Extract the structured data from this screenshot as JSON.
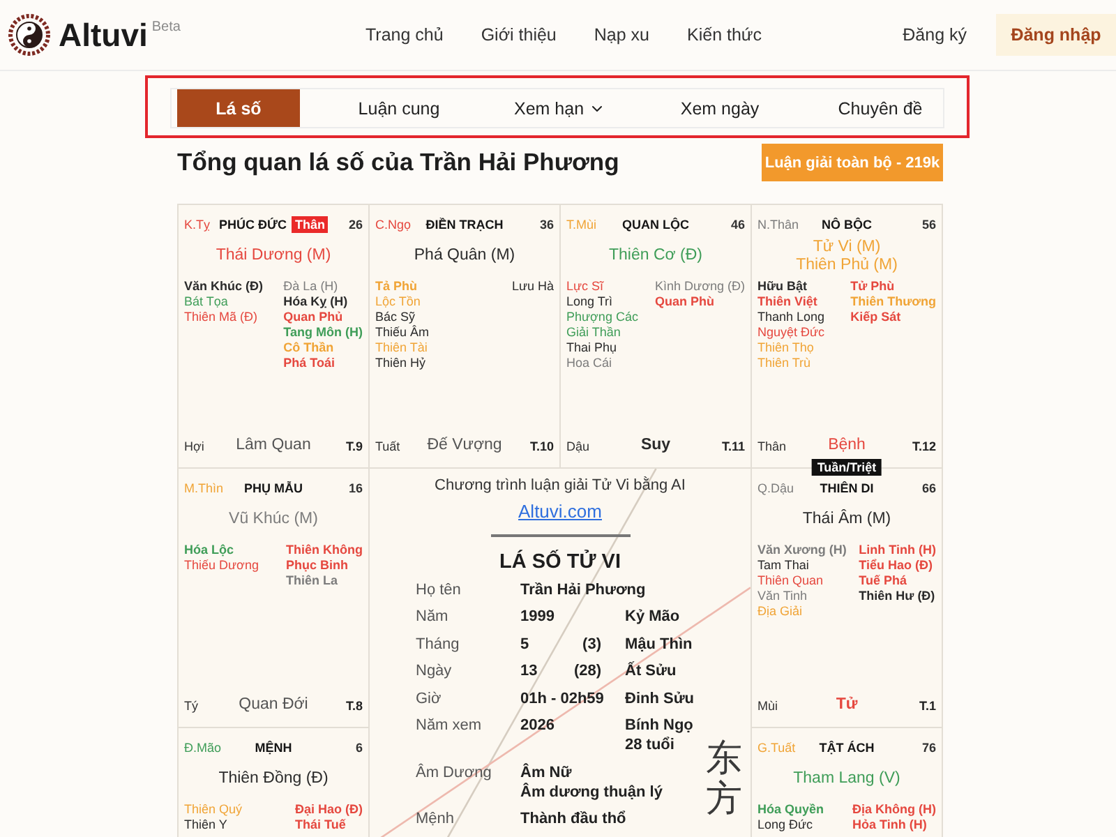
{
  "header": {
    "brand": "Altuvi",
    "badge": "Beta",
    "nav": [
      "Trang chủ",
      "Giới thiệu",
      "Nạp xu",
      "Kiến thức"
    ],
    "register": "Đăng ký",
    "login": "Đăng nhập"
  },
  "tabs": [
    {
      "label": "Lá số",
      "selected": true,
      "has_menu": false
    },
    {
      "label": "Luận cung",
      "selected": false,
      "has_menu": false
    },
    {
      "label": "Xem hạn",
      "selected": false,
      "has_menu": true
    },
    {
      "label": "Xem ngày",
      "selected": false,
      "has_menu": false
    },
    {
      "label": "Chuyên đề",
      "selected": false,
      "has_menu": false
    }
  ],
  "title": "Tổng quan lá số của Trần Hải Phương",
  "action_button": "Luận giải toàn bộ - 219k",
  "chart": {
    "palaces": [
      {
        "can_chi": {
          "text": "K.Tỵ",
          "color": "#e5483f"
        },
        "name": "PHÚC ĐỨC",
        "tag": "Thân",
        "age": "26",
        "main_stars": [
          {
            "name": "Thái Dương (M)",
            "color": "#e5483f"
          }
        ],
        "left_stars": [
          {
            "name": "Văn Khúc (Đ)",
            "color": "#2b2b2b",
            "bold": true
          },
          {
            "name": "Bát Tọa",
            "color": "#3f9d58",
            "bold": false
          },
          {
            "name": "Thiên Mã (Đ)",
            "color": "#e5483f",
            "bold": false
          }
        ],
        "right_stars": [
          {
            "name": "Đà La (H)",
            "color": "#7c7c7c",
            "bold": false
          },
          {
            "name": "Hóa Kỵ (H)",
            "color": "#2b2b2b",
            "bold": true
          },
          {
            "name": "Quan Phủ",
            "color": "#e5483f",
            "bold": true
          },
          {
            "name": "Tang Môn (H)",
            "color": "#3f9d58",
            "bold": true
          },
          {
            "name": "Cô Thần",
            "color": "#f0a436",
            "bold": true
          },
          {
            "name": "Phá Toái",
            "color": "#e5483f",
            "bold": true
          }
        ],
        "footer": {
          "branch": "Hợi",
          "stage": {
            "text": "Lâm Quan",
            "color": "#555555",
            "bold": false
          },
          "month": "T.9"
        }
      },
      {
        "can_chi": {
          "text": "C.Ngọ",
          "color": "#e5483f"
        },
        "name": "ĐIỀN TRẠCH",
        "age": "36",
        "main_stars": [
          {
            "name": "Phá Quân (M)",
            "color": "#2b2b2b"
          }
        ],
        "left_stars": [
          {
            "name": "Tả Phù",
            "color": "#f0a436",
            "bold": true
          },
          {
            "name": "Lộc Tồn",
            "color": "#f0a436",
            "bold": false
          },
          {
            "name": "Bác Sỹ",
            "color": "#2b2b2b",
            "bold": false
          },
          {
            "name": "Thiếu Âm",
            "color": "#2b2b2b",
            "bold": false
          },
          {
            "name": "Thiên Tài",
            "color": "#f0a436",
            "bold": false
          },
          {
            "name": "Thiên Hỷ",
            "color": "#2b2b2b",
            "bold": false
          }
        ],
        "right_stars": [
          {
            "name": "Lưu Hà",
            "color": "#2b2b2b",
            "bold": false
          }
        ],
        "footer": {
          "branch": "Tuất",
          "stage": {
            "text": "Đế Vượng",
            "color": "#555555",
            "bold": false
          },
          "month": "T.10"
        }
      },
      {
        "can_chi": {
          "text": "T.Mùi",
          "color": "#f0a436"
        },
        "name": "QUAN LỘC",
        "age": "46",
        "main_stars": [
          {
            "name": "Thiên Cơ (Đ)",
            "color": "#3f9d58"
          }
        ],
        "left_stars": [
          {
            "name": "Lực Sĩ",
            "color": "#e5483f",
            "bold": false
          },
          {
            "name": "Long Trì",
            "color": "#2b2b2b",
            "bold": false
          },
          {
            "name": "Phượng Các",
            "color": "#3f9d58",
            "bold": false
          },
          {
            "name": "Giải Thần",
            "color": "#3f9d58",
            "bold": false
          },
          {
            "name": "Thai Phụ",
            "color": "#2b2b2b",
            "bold": false
          },
          {
            "name": "Hoa Cái",
            "color": "#7c7c7c",
            "bold": false
          }
        ],
        "right_stars": [
          {
            "name": "Kình Dương (Đ)",
            "color": "#7c7c7c",
            "bold": false
          },
          {
            "name": "Quan Phù",
            "color": "#e5483f",
            "bold": true
          }
        ],
        "footer": {
          "branch": "Dậu",
          "stage": {
            "text": "Suy",
            "color": "#2b2b2b",
            "bold": true
          },
          "month": "T.11"
        }
      },
      {
        "can_chi": {
          "text": "N.Thân",
          "color": "#7c7c7c"
        },
        "name": "NÔ BỘC",
        "age": "56",
        "main_stars": [
          {
            "name": "Tử Vi (M)",
            "color": "#f0a436"
          },
          {
            "name": "Thiên Phủ (M)",
            "color": "#f0a436"
          }
        ],
        "left_stars": [
          {
            "name": "Hữu Bật",
            "color": "#2b2b2b",
            "bold": true
          },
          {
            "name": "Thiên Việt",
            "color": "#e5483f",
            "bold": true
          },
          {
            "name": "Thanh Long",
            "color": "#2b2b2b",
            "bold": false
          },
          {
            "name": "Nguyệt Đức",
            "color": "#e5483f",
            "bold": false
          },
          {
            "name": "Thiên Thọ",
            "color": "#f0a436",
            "bold": false
          },
          {
            "name": "Thiên Trù",
            "color": "#f0a436",
            "bold": false
          }
        ],
        "right_stars": [
          {
            "name": "Tử Phù",
            "color": "#e5483f",
            "bold": true
          },
          {
            "name": "Thiên Thương",
            "color": "#f0a436",
            "bold": true
          },
          {
            "name": "Kiếp Sát",
            "color": "#e5483f",
            "bold": true
          }
        ],
        "footer": {
          "branch": "Thân",
          "stage": {
            "text": "Bệnh",
            "color": "#e5483f",
            "bold": false
          },
          "month": "T.12"
        }
      },
      {
        "can_chi": {
          "text": "M.Thìn",
          "color": "#f0a436"
        },
        "name": "PHỤ MẪU",
        "age": "16",
        "main_stars": [
          {
            "name": "Vũ Khúc (M)",
            "color": "#7c7c7c"
          }
        ],
        "left_stars": [
          {
            "name": "Hóa Lộc",
            "color": "#3f9d58",
            "bold": true
          },
          {
            "name": "Thiếu Dương",
            "color": "#e5483f",
            "bold": false
          }
        ],
        "right_stars": [
          {
            "name": "Thiên Không",
            "color": "#e5483f",
            "bold": true
          },
          {
            "name": "Phục Binh",
            "color": "#e5483f",
            "bold": true
          },
          {
            "name": "Thiên La",
            "color": "#7c7c7c",
            "bold": true
          }
        ],
        "footer": {
          "branch": "Tý",
          "stage": {
            "text": "Quan Đới",
            "color": "#555555",
            "bold": false
          },
          "month": "T.8"
        }
      },
      {
        "can_chi": {
          "text": "Q.Dậu",
          "color": "#7c7c7c"
        },
        "name": "THIÊN DI",
        "age": "66",
        "marker": "Tuần/Triệt",
        "main_stars": [
          {
            "name": "Thái Âm (M)",
            "color": "#2b2b2b"
          }
        ],
        "left_stars": [
          {
            "name": "Văn Xương (H)",
            "color": "#7c7c7c",
            "bold": true
          },
          {
            "name": "Tam Thai",
            "color": "#2b2b2b",
            "bold": false
          },
          {
            "name": "Thiên Quan",
            "color": "#e5483f",
            "bold": false
          },
          {
            "name": "Văn Tinh",
            "color": "#7c7c7c",
            "bold": false
          },
          {
            "name": "Địa Giải",
            "color": "#f0a436",
            "bold": false
          }
        ],
        "right_stars": [
          {
            "name": "Linh Tinh (H)",
            "color": "#e5483f",
            "bold": true
          },
          {
            "name": "Tiểu Hao (Đ)",
            "color": "#e5483f",
            "bold": true
          },
          {
            "name": "Tuế Phá",
            "color": "#e5483f",
            "bold": true
          },
          {
            "name": "Thiên Hư (Đ)",
            "color": "#2b2b2b",
            "bold": true
          }
        ],
        "footer": {
          "branch": "Mùi",
          "stage": {
            "text": "Tử",
            "color": "#e5483f",
            "bold": true
          },
          "month": "T.1"
        }
      },
      {
        "can_chi": {
          "text": "Đ.Mão",
          "color": "#3f9d58"
        },
        "name": "MỆNH",
        "age": "6",
        "main_stars": [
          {
            "name": "Thiên Đồng (Đ)",
            "color": "#2b2b2b"
          }
        ],
        "left_stars": [
          {
            "name": "Thiên Quý",
            "color": "#f0a436",
            "bold": false
          },
          {
            "name": "Thiên Y",
            "color": "#2b2b2b",
            "bold": false
          }
        ],
        "right_stars": [
          {
            "name": "Đại Hao (Đ)",
            "color": "#e5483f",
            "bold": true
          },
          {
            "name": "Thái Tuế",
            "color": "#e5483f",
            "bold": true
          }
        ]
      },
      {
        "can_chi": {
          "text": "G.Tuất",
          "color": "#f0a436"
        },
        "name": "TẬT ÁCH",
        "age": "76",
        "main_stars": [
          {
            "name": "Tham Lang (V)",
            "color": "#3f9d58"
          }
        ],
        "left_stars": [
          {
            "name": "Hóa Quyền",
            "color": "#3f9d58",
            "bold": true
          },
          {
            "name": "Long Đức",
            "color": "#2b2b2b",
            "bold": false
          }
        ],
        "right_stars": [
          {
            "name": "Địa Không (H)",
            "color": "#e5483f",
            "bold": true
          },
          {
            "name": "Hỏa Tinh (H)",
            "color": "#e5483f",
            "bold": true
          }
        ]
      }
    ],
    "center": {
      "intro": "Chương trình luận giải Tử Vi bằng AI",
      "link": "Altuvi.com",
      "heading": "LÁ SỐ TỬ VI",
      "rows": [
        {
          "label": "Họ tên",
          "value": [
            "Trần Hải Phương"
          ]
        },
        {
          "label": "Năm",
          "value": [
            "1999"
          ],
          "can_chi": [
            "Kỷ Mão"
          ]
        },
        {
          "label": "Tháng",
          "value": [
            "5"
          ],
          "lunar": "(3)",
          "can_chi": [
            "Mậu Thìn"
          ]
        },
        {
          "label": "Ngày",
          "value": [
            "13"
          ],
          "lunar": "(28)",
          "can_chi": [
            "Ất Sửu"
          ]
        },
        {
          "label": "Giờ",
          "value": [
            "01h - 02h59"
          ],
          "can_chi": [
            "Đinh Sửu"
          ]
        },
        {
          "label": "Năm xem",
          "value": [
            "2026"
          ],
          "can_chi": [
            "Bính Ngọ",
            "28 tuổi"
          ]
        },
        {
          "label": "Âm Dương",
          "value": [
            "Âm Nữ",
            "Âm dương thuận lý"
          ]
        },
        {
          "label": "Mệnh",
          "value": [
            "Thành đầu thổ"
          ]
        }
      ],
      "calligraphy": "东方"
    }
  }
}
